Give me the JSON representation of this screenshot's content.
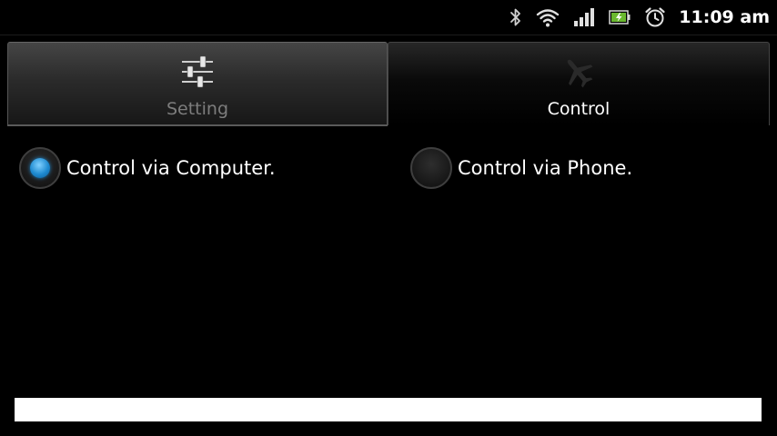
{
  "status_bar": {
    "time": "11:09 am",
    "icons": [
      "bluetooth-icon",
      "wifi-icon",
      "signal-icon",
      "battery-charging-icon",
      "alarm-clock-icon"
    ]
  },
  "tabs": [
    {
      "label": "Setting",
      "icon": "sliders-icon",
      "selected": false
    },
    {
      "label": "Control",
      "icon": "airplane-icon",
      "selected": true
    }
  ],
  "options": [
    {
      "label": "Control via Computer.",
      "checked": true
    },
    {
      "label": "Control via Phone.",
      "checked": false
    }
  ],
  "colors": {
    "background": "#000000",
    "radio_selected": "#1e8ad0",
    "tab_inactive_text": "#7d7d7d",
    "bottom_bar": "#ffffff"
  }
}
